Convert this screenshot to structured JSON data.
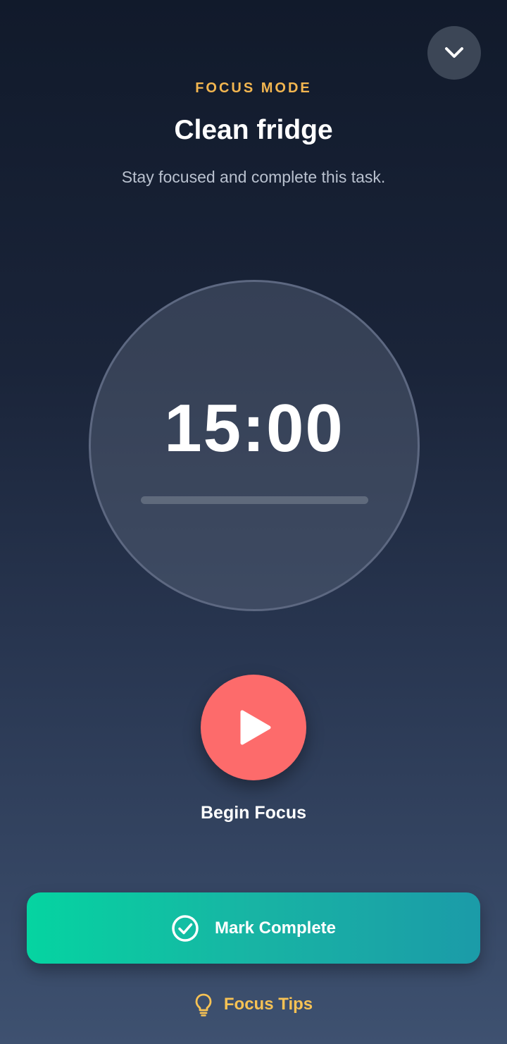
{
  "header": {
    "collapse_icon": "chevron-down-icon",
    "eyebrow": "FOCUS MODE",
    "title": "Clean fridge",
    "subtitle": "Stay focused and complete this task."
  },
  "timer": {
    "value": "15:00",
    "progress": 0.0
  },
  "controls": {
    "play_icon": "play-icon",
    "begin_label": "Begin Focus",
    "complete_icon": "check-circle-icon",
    "complete_label": "Mark Complete",
    "tips_icon": "lightbulb-icon",
    "tips_label": "Focus Tips"
  },
  "colors": {
    "accent_yellow": "#f3b650",
    "play_red": "#fd6b6b",
    "complete_green": "#05d4a1",
    "complete_teal": "#1b9ba8"
  }
}
